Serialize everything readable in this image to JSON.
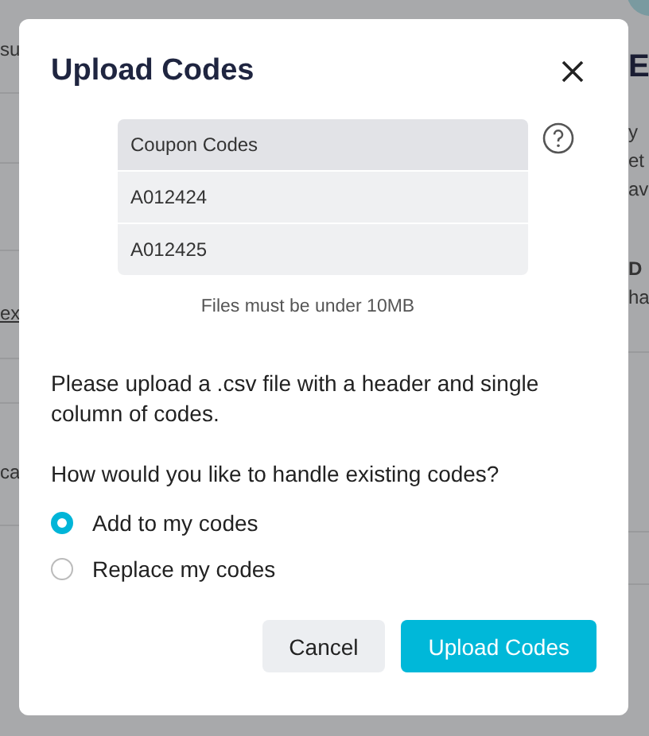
{
  "background": {
    "left_fragments": [
      {
        "text": "su",
        "kind": "text"
      },
      {
        "text": "ex",
        "kind": "link"
      },
      {
        "text": "ca",
        "kind": "text"
      }
    ],
    "right_fragments": [
      {
        "text": "E",
        "kind": "heading"
      },
      {
        "text": "y",
        "kind": "text"
      },
      {
        "text": "et",
        "kind": "text"
      },
      {
        "text": "av",
        "kind": "text"
      },
      {
        "text": "D",
        "kind": "bold"
      },
      {
        "text": "ha",
        "kind": "text"
      }
    ]
  },
  "dialog": {
    "title": "Upload Codes",
    "table": {
      "header": "Coupon Codes",
      "rows": [
        "A012424",
        "A012425"
      ]
    },
    "note": "Files must be under 10MB",
    "instructions": "Please upload a .csv file with a header and single column of codes.",
    "question": "How would you like to handle existing codes?",
    "options": [
      {
        "label": "Add to my codes",
        "selected": true
      },
      {
        "label": "Replace my codes",
        "selected": false
      }
    ],
    "buttons": [
      {
        "label": "Cancel",
        "kind": "secondary"
      },
      {
        "label": "Upload Codes",
        "kind": "primary"
      }
    ]
  }
}
